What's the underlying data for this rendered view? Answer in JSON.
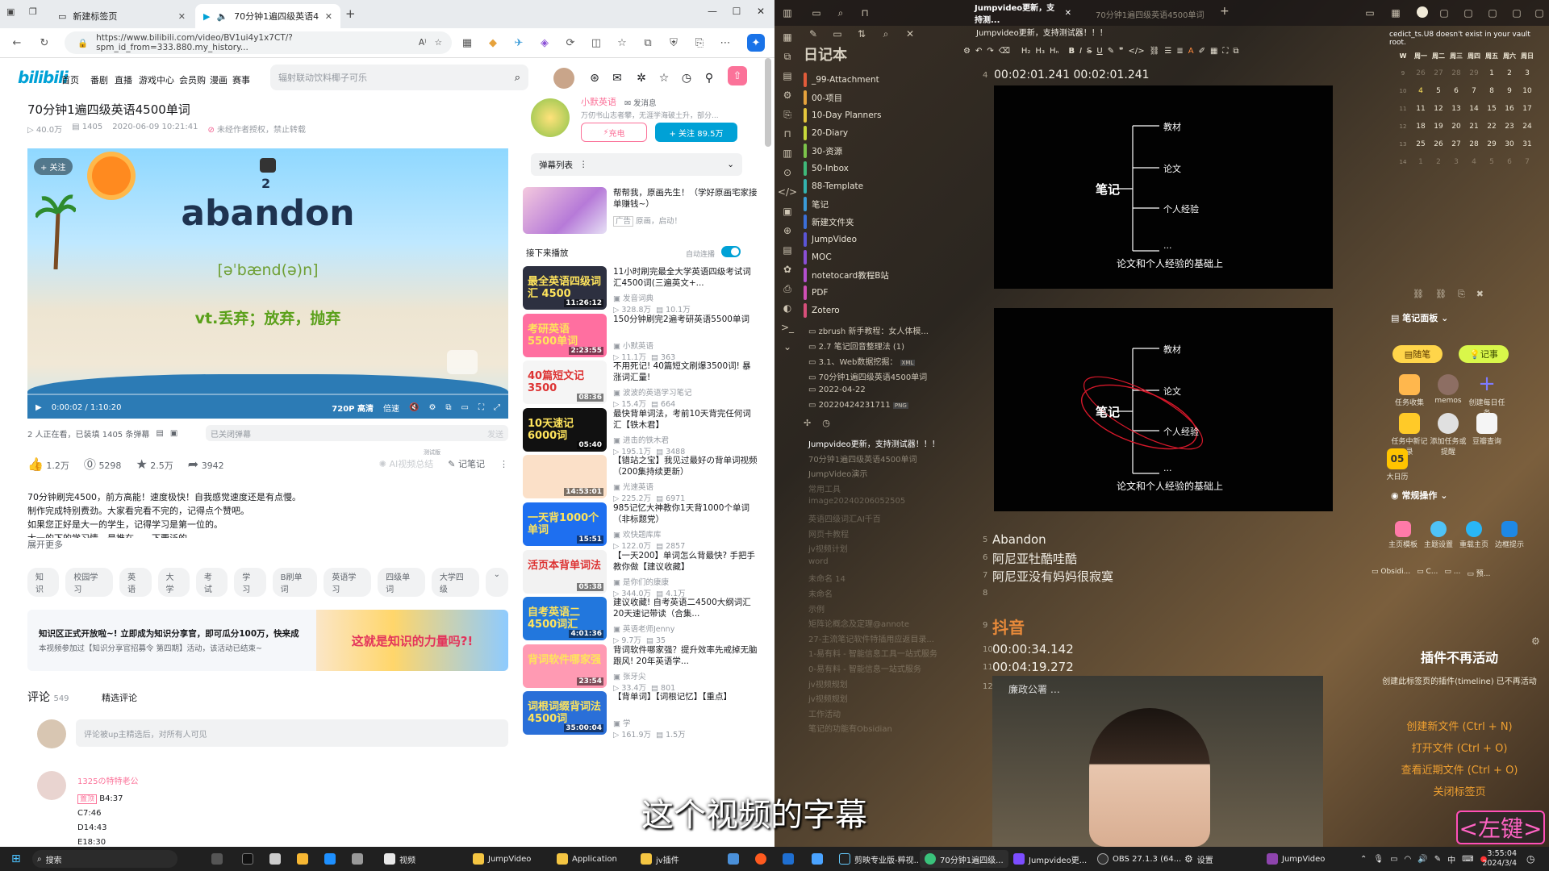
{
  "browser": {
    "tabs": [
      "新建标签页",
      "70分钟1遍四级英语4500单..."
    ],
    "url": "https://www.bilibili.com/video/BV1ui4y1x7CT/?spm_id_from=333.880.my_history...",
    "nav": {
      "logo": "bilibili",
      "items": [
        "首页",
        "番剧",
        "直播",
        "游戏中心",
        "会员购",
        "漫画",
        "赛事"
      ],
      "search_placeholder": "辐射联动饮料椰子可乐"
    },
    "video": {
      "title": "70分钟1遍四级英语4500单词",
      "views": "40.0万",
      "danmaku_count": "1405",
      "date": "2020-06-09 10:21:41",
      "warning": "未经作者授权，禁止转载",
      "badge_number": "2",
      "word": "abandon",
      "phonetic": "[əˈbænd(ə)n]",
      "meaning": "vt.丢弃；放弃，抛弃",
      "follow_label": "+ 关注",
      "time": "0:00:02 / 1:10:20",
      "quality": "720P 高清",
      "speed": "倍速",
      "watching": "2 人正在看，已装填 1405 条弹幕",
      "danmaku_closed": "已关闭弹幕",
      "send": "发送",
      "likes": "1.2万",
      "coins": "5298",
      "favs": "2.5万",
      "shares": "3942",
      "ai_summary": "AI视频总结",
      "ai_test": "测试版",
      "note": "记笔记",
      "description": [
        "70分钟刷完4500，前方高能！速度极快！自我感觉速度还是有点慢。",
        "制作完成特别费劲。大家看完看不完的，记得点个赞吧。",
        "如果您正好是大一的学生，记得学习是第一位的。",
        "大一的下的学习情，是推在……下要泛的"
      ],
      "expand": "展开更多",
      "tags": [
        "知识",
        "校园学习",
        "英语",
        "大学",
        "考试",
        "学习",
        "B刷单词",
        "英语学习",
        "四级单词",
        "大学四级"
      ],
      "banner_title": "知识区正式开放啦~! 立即成为知识分享官，即可瓜分100万，快来成",
      "banner_sub": "本视频参加过【知识分享官招募令 第四期】活动，该活动已结束~",
      "banner_art": "这就是知识的力量吗?!",
      "comments_label": "评论",
      "comments_count": "549",
      "comments_filter": "精选评论",
      "comment_placeholder": "评论被up主精选后，对所有人可见",
      "commenter": "1325の特特老公",
      "comment_lines": [
        "B4:37",
        "C7:46",
        "D14:43",
        "E18:30"
      ],
      "comment_badge": "置顶"
    },
    "uploader": {
      "name": "小默英语",
      "msg": "发消息",
      "desc": "万仞书山志者攀，无涯学海破土升，部分...",
      "charge": "充电",
      "follow": "+ 关注 89.5万"
    },
    "danmaku_list": "弹幕列表",
    "ad": {
      "title": "帮帮我，原画先生！（学好原画宅家接单赚钱~）",
      "sub": "原画，启动！"
    },
    "up_next": "接下来播放",
    "autoplay": "自动连播",
    "recommend": [
      {
        "title": "11小时刷完最全大学英语四级考试词汇4500词(三遍英文+...",
        "up": "发音词典",
        "views": "328.8万",
        "dm": "10.1万",
        "dur": "11:26:12",
        "thumb": "最全英语四级词汇 4500"
      },
      {
        "title": "150分钟刷完2遍考研英语5500单词",
        "up": "小默英语",
        "views": "11.1万",
        "dm": "363",
        "dur": "2:23:55",
        "thumb": "考研英语 5500单词"
      },
      {
        "title": "不用死记! 40篇短文刷爆3500词! 暴涨词汇量!",
        "up": "波波的英语学习笔记",
        "views": "15.4万",
        "dm": "664",
        "dur": "08:36",
        "thumb": "40篇短文记3500"
      },
      {
        "title": "最快背单词法，考前10天背完任何词汇【铁木君】",
        "up": "进击的铁木君",
        "views": "195.1万",
        "dm": "3488",
        "dur": "05:40",
        "thumb": "10天速记6000词"
      },
      {
        "title": "【错站之宝】我见过最好の背单词视频（200集持续更新）",
        "up": "光速英语",
        "views": "225.2万",
        "dm": "6971",
        "dur": "14:53:01",
        "thumb": ""
      },
      {
        "title": "985记忆大神教你1天背1000个单词（非标题党）",
        "up": "欢快题库库",
        "views": "122.0万",
        "dm": "2857",
        "dur": "15:51",
        "thumb": "一天背1000个单词"
      },
      {
        "title": "【一天200】单词怎么背最快? 手把手教你做【建议收藏】",
        "up": "是你们的康康",
        "views": "344.0万",
        "dm": "4.1万",
        "dur": "05:38",
        "thumb": "活页本背单词法"
      },
      {
        "title": "建议收藏! 自考英语二4500大纲词汇20天速记带读（合集...",
        "up": "英语老师Jenny",
        "views": "9.7万",
        "dm": "35",
        "dur": "4:01:36",
        "thumb": "自考英语二 4500词汇"
      },
      {
        "title": "背词软件哪家强？提升效率先戒掉无脑跟风! 20年英语学...",
        "up": "张牙尖",
        "views": "33.4万",
        "dm": "801",
        "dur": "23:54",
        "thumb": "背词软件哪家强"
      },
      {
        "title": "【背单词】【词根记忆】【重点】",
        "up": "学",
        "views": "161.9万",
        "dm": "1.5万",
        "dur": "35:00:04",
        "thumb": "词根词缀背词法 4500词"
      }
    ]
  },
  "obsidian": {
    "tabs": [
      "Jumpvideo更新，支持测...",
      "70分钟1遍四级英语4500单词"
    ],
    "open_note": "Jumpvideo更新，支持测试器！！！",
    "vault_error": "cedict_ts.U8 doesn't exist in your vault root.",
    "vault_name": "日记本",
    "folders": [
      {
        "name": "_99-Attachment",
        "color": "#e25b3a"
      },
      {
        "name": "00-项目",
        "color": "#e6a23c"
      },
      {
        "name": "10-Day Planners",
        "color": "#e6c73c"
      },
      {
        "name": "20-Diary",
        "color": "#c8d93a"
      },
      {
        "name": "30-资源",
        "color": "#7cc44a"
      },
      {
        "name": "50-Inbox",
        "color": "#3fb97a"
      },
      {
        "name": "88-Template",
        "color": "#33b3b0"
      },
      {
        "name": "笔记",
        "color": "#3a9bd8"
      },
      {
        "name": "新建文件夹",
        "color": "#3b6fd8"
      },
      {
        "name": "JumpVideo",
        "color": "#5b55d6"
      },
      {
        "name": "MOC",
        "color": "#8a4fd6"
      },
      {
        "name": "notetocard教程B站",
        "color": "#b44fd0"
      },
      {
        "name": "PDF",
        "color": "#d04fb5"
      },
      {
        "name": "Zotero",
        "color": "#d84f7a"
      }
    ],
    "files": [
      "zbrush 新手教程：女人体模...",
      "2.7 笔记回音整理法 (1)",
      "3.1、Web数据挖掘：",
      "70分钟1遍四级英语4500单词",
      "2022-04-22",
      "20220424231711"
    ],
    "file_badges": [
      "XML",
      "PNG"
    ],
    "recent": [
      "Jumpvideo更新，支持测试器！！！",
      "70分钟1遍四级英语4500单词",
      "JumpVideo演示",
      "常用工具",
      "image20240206052505",
      "英语四级词汇AI千百",
      "网页卡教程",
      "jv视频计划",
      "word",
      "未命名 14",
      "未命名",
      "示例",
      "矩阵论概念及定理@annote",
      "27-主流笔记软件特插用应返目录...",
      "1-易有料 - 智能信息工具一站式服务",
      "0-易有料 - 智能信息一站式服务",
      "jv视频规划",
      "jv视频规划",
      "工作活动",
      "笔记的功能有Obsidian"
    ],
    "note": {
      "line4": "00:02:01.241 00:02:01.241",
      "line5": "Abandon",
      "line6": "阿尼亚牡酷哇酷",
      "line7": "阿尼亚没有妈妈很寂寞",
      "line9": "抖音",
      "line10": "00:00:34.142",
      "line11": "00:04:19.272",
      "line_nums": [
        "4",
        "5",
        "6",
        "7",
        "8",
        "9",
        "10",
        "11",
        "12"
      ]
    },
    "mindmap": {
      "root": "笔记",
      "b1": "教材",
      "b2": "论文",
      "b3": "个人经验",
      "b4": "...",
      "caption": "论文和个人经验的基础上"
    },
    "calendar": {
      "header": [
        "W",
        "周一",
        "周二",
        "周三",
        "周四",
        "周五",
        "周六",
        "周日"
      ],
      "rows": [
        [
          "9",
          "26",
          "27",
          "28",
          "29",
          "1",
          "2",
          "3"
        ],
        [
          "10",
          "4",
          "5",
          "6",
          "7",
          "8",
          "9",
          "10"
        ],
        [
          "11",
          "11",
          "12",
          "13",
          "14",
          "15",
          "16",
          "17"
        ],
        [
          "12",
          "18",
          "19",
          "20",
          "21",
          "22",
          "23",
          "24"
        ],
        [
          "13",
          "25",
          "26",
          "27",
          "28",
          "29",
          "30",
          "31"
        ],
        [
          "14",
          "1",
          "2",
          "3",
          "4",
          "5",
          "6",
          "7"
        ]
      ]
    },
    "panel": {
      "title": "笔记面板",
      "btn1": "随笔",
      "btn2": "记事",
      "items": [
        "任务收集",
        "memos",
        "创建每日任务",
        "任务中新记录",
        "添加任务或提醒",
        "豆瓣查询",
        "大日历"
      ],
      "section": "常规操作",
      "ops": [
        "主页模板",
        "主题设置",
        "重载主页",
        "边框提示"
      ],
      "footer": [
        "Obsidi...",
        "C...",
        "...",
        "预..."
      ]
    },
    "plugin": {
      "title": "插件不再活动",
      "desc": "创建此标签页的插件(timeline) 已不再活动",
      "links": [
        "创建新文件 (Ctrl + N)",
        "打开文件 (Ctrl + O)",
        "查看近期文件 (Ctrl + O)",
        "关闭标签页"
      ]
    },
    "subtitle": "这个视频的字幕",
    "left_key": "<左键>",
    "woman_caption": "廉政公署 …"
  },
  "taskbar": {
    "search": "搜索",
    "apps": [
      "视频",
      "JumpVideo",
      "Application",
      "jv插件",
      "剪映专业版-粹视...",
      "70分钟1遍四级...",
      "Jumpvideo更...",
      "OBS 27.1.3 (64...",
      "设置",
      "JumpVideo"
    ],
    "time": "3:55:04",
    "date": "2024/3/4"
  }
}
